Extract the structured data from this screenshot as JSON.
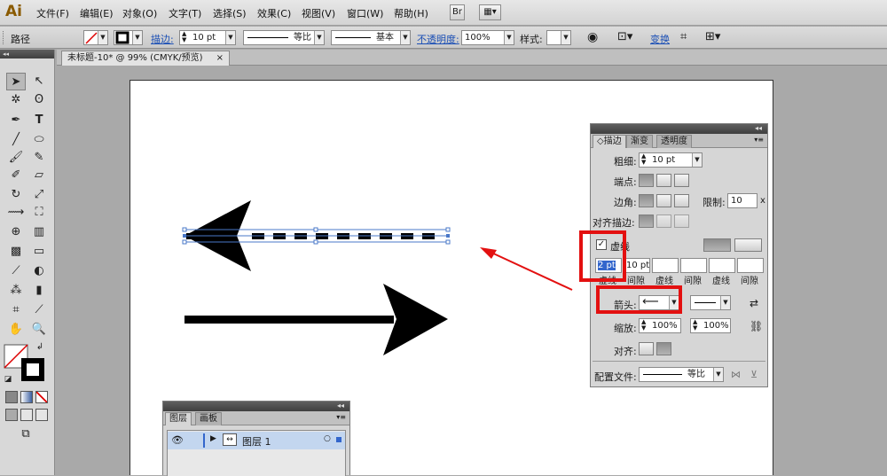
{
  "app": {
    "logo": "Ai",
    "br_button": "Br"
  },
  "menu": [
    "文件(F)",
    "编辑(E)",
    "对象(O)",
    "文字(T)",
    "选择(S)",
    "效果(C)",
    "视图(V)",
    "窗口(W)",
    "帮助(H)"
  ],
  "control": {
    "selection_label": "路径",
    "stroke_link": "描边:",
    "stroke_weight": "10 pt",
    "profile": "等比",
    "brush": "基本",
    "opacity_link": "不透明度:",
    "opacity_value": "100%",
    "style_label": "样式:",
    "transform_link": "变换"
  },
  "document": {
    "tab_title": "未标题-10* @ 99% (CMYK/预览)",
    "close": "×"
  },
  "stroke_panel": {
    "collapse": "◂◂",
    "close": "×",
    "tabs": [
      "◇描边",
      "渐变",
      "透明度"
    ],
    "weight_label": "粗细:",
    "weight_value": "10 pt",
    "cap_label": "端点:",
    "corner_label": "边角:",
    "limit_label": "限制:",
    "limit_value": "10",
    "limit_unit": "x",
    "align_label": "对齐描边:",
    "dashed_checked": true,
    "dashed_label": "虚线",
    "check_mark": "✓",
    "dash_values": [
      "2 pt",
      "10 pt",
      "",
      "",
      "",
      ""
    ],
    "dash_headers": [
      "虚线",
      "间隙",
      "虚线",
      "间隙",
      "虚线",
      "间隙"
    ],
    "arrow_label": "箭头:",
    "scale_label": "缩放:",
    "scale_start": "100%",
    "scale_end": "100%",
    "align_arrow_label": "对齐:",
    "profile_label": "配置文件:",
    "profile_value": "等比"
  },
  "layers_panel": {
    "collapse": "◂◂",
    "close": "×",
    "tabs": [
      "图层",
      "画板"
    ],
    "layer_name": "图层 1"
  },
  "colors": {
    "highlight": "#e31010",
    "selection": "#4a78c8"
  }
}
